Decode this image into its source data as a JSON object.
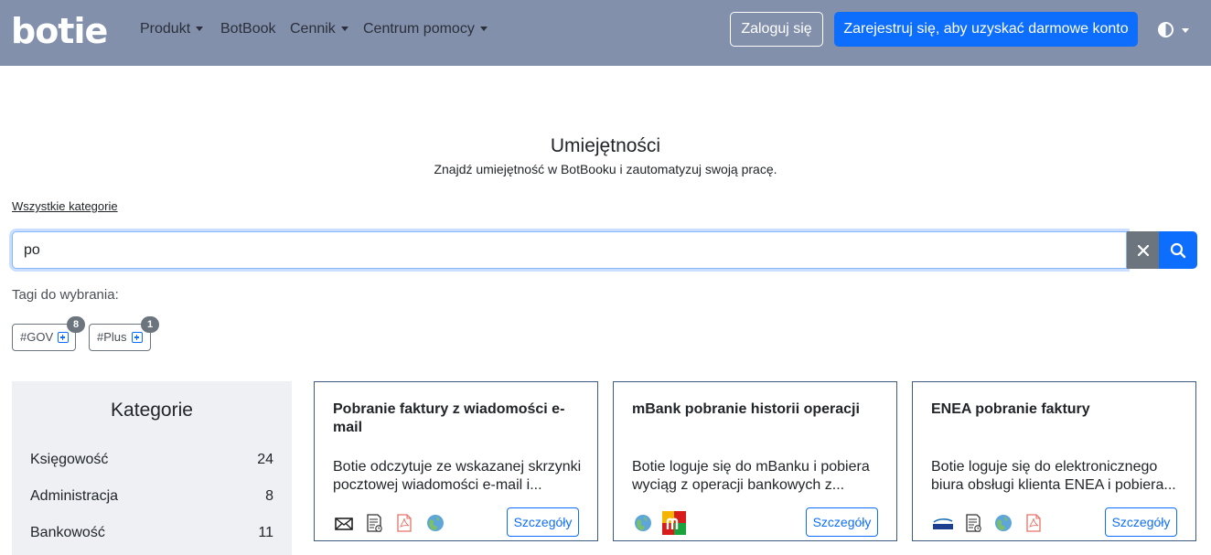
{
  "brand": {
    "logo": "botie"
  },
  "nav": {
    "items": [
      {
        "label": "Produkt",
        "dropdown": true
      },
      {
        "label": "BotBook",
        "dropdown": false
      },
      {
        "label": "Cennik",
        "dropdown": true
      },
      {
        "label": "Centrum pomocy",
        "dropdown": true
      }
    ],
    "login_label": "Zaloguj się",
    "register_label": "Zarejestruj się, aby uzyskać darmowe konto",
    "theme_icon": "half-circle-contrast-icon"
  },
  "header": {
    "title": "Umiejętności",
    "subtitle": "Znajdź umiejętność w BotBooku i zautomatyzuj swoją pracę."
  },
  "all_categories_label": "Wszystkie kategorie",
  "search": {
    "value": "po",
    "clear_icon": "close-icon",
    "search_icon": "search-icon"
  },
  "tags": {
    "label": "Tagi do wybrania:",
    "items": [
      {
        "label": "#GOV",
        "count": "8"
      },
      {
        "label": "#Plus",
        "count": "1"
      }
    ]
  },
  "sidebar": {
    "title": "Kategorie",
    "categories": [
      {
        "name": "Księgowość",
        "count": "24"
      },
      {
        "name": "Administracja",
        "count": "8"
      },
      {
        "name": "Bankowość",
        "count": "11"
      }
    ]
  },
  "cards": [
    {
      "title": "Pobranie faktury z wiadomości e-mail",
      "description": "Botie odczytuje ze wskazanej skrzynki pocztowej wiadomości e-mail i...",
      "button": "Szczegóły",
      "icons": [
        "mail-envelope-icon",
        "document-icon",
        "pdf-icon",
        "globe-browser-icon"
      ]
    },
    {
      "title": "mBank pobranie historii operacji",
      "description": "Botie loguje się do mBanku i pobiera wyciąg z operacji bankowych z...",
      "button": "Szczegóły",
      "icons": [
        "globe-browser-icon",
        "mbank-logo-icon"
      ]
    },
    {
      "title": "ENEA pobranie faktury",
      "description": "Botie loguje się do elektronicznego biura obsługi klienta ENEA i pobiera...",
      "button": "Szczegóły",
      "icons": [
        "enea-logo-icon",
        "document-icon",
        "globe-browser-icon",
        "pdf-icon"
      ]
    }
  ],
  "colors": {
    "navbar": "#8290ab",
    "primary": "#0d6efd",
    "secondary": "#6c757d",
    "sidebar_bg": "#eef0f4",
    "card_border": "#3d5a80"
  }
}
